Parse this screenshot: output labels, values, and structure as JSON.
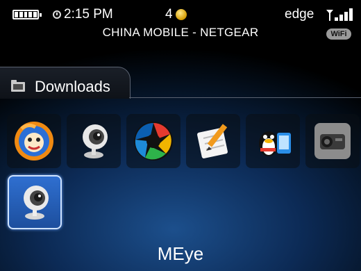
{
  "status_bar": {
    "time": "2:15 PM",
    "notification_count": "4",
    "carrier": "CHINA MOBILE - NETGEAR",
    "network": "edge",
    "wifi_badge": "WiFi",
    "icons": [
      "battery-icon",
      "alarm-clock-icon",
      "notification-dot-icon",
      "signal-strength-icon"
    ]
  },
  "folder": {
    "label": "Downloads",
    "icon": "folder-icon"
  },
  "apps": [
    {
      "icon": "uc-browser-icon"
    },
    {
      "icon": "webcam-icon"
    },
    {
      "icon": "aperture-camera-icon"
    },
    {
      "icon": "notes-pencil-icon"
    },
    {
      "icon": "qq-penguin-icon"
    },
    {
      "icon": "video-camera-icon"
    },
    {
      "icon": "meye-webcam-icon",
      "selected": true
    }
  ],
  "selected_app_label": "MEye",
  "colors": {
    "selection": "#2f6fd0",
    "background": "#0c2a55"
  }
}
